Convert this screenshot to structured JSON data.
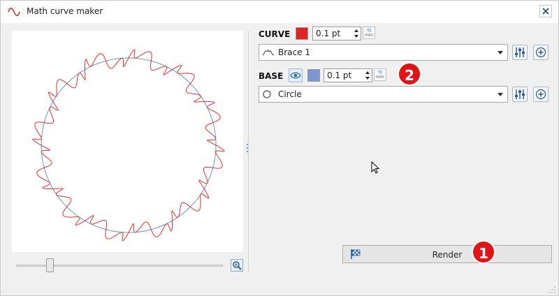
{
  "window": {
    "title": "Math curve maker",
    "icon": "sine-wave-icon",
    "close_icon": "close-icon"
  },
  "preview": {
    "description_icon": "curve-preview",
    "zoom_slider_value": 0.15,
    "zoom_button_icon": "zoom-icon",
    "curve_color": "#e03030",
    "base_color": "#6e94c8"
  },
  "curve": {
    "label": "CURVE",
    "color": "#e02424",
    "thickness": "0.1 pt",
    "unit_top": "⟲",
    "unit_bottom": "mm",
    "shape": "Brace 1",
    "shape_icon": "brace-icon",
    "settings_icon": "sliders-icon",
    "add_icon": "plus-circle-icon"
  },
  "base": {
    "label": "BASE",
    "visibility_icon": "eye-icon",
    "color": "#7b96d0",
    "thickness": "0.1 pt",
    "unit_top": "⟲",
    "unit_bottom": "mm",
    "shape": "Circle",
    "shape_icon": "circle-icon",
    "settings_icon": "sliders-icon",
    "add_icon": "plus-circle-icon"
  },
  "badges": {
    "one": "1",
    "two": "2",
    "color": "#e01414"
  },
  "render": {
    "label": "Render",
    "icon": "checkered-flag-icon"
  }
}
